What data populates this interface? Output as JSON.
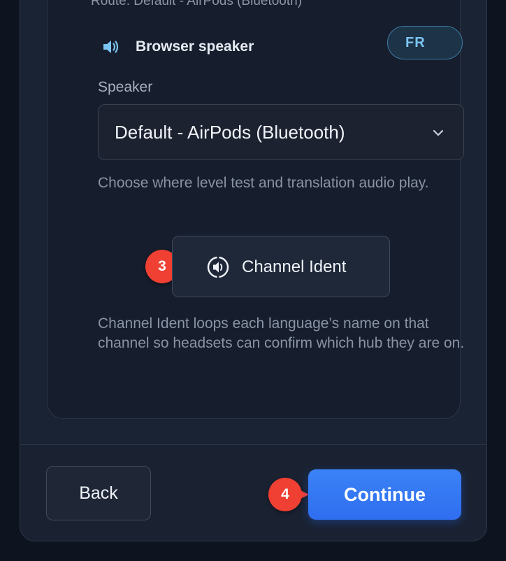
{
  "route_text": "Route: Default - AirPods (Bluetooth)",
  "speaker_row": {
    "icon": "speaker-wave-icon",
    "label": "Browser speaker",
    "language_pill": "FR"
  },
  "speaker_field": {
    "label": "Speaker",
    "selected": "Default - AirPods (Bluetooth)",
    "help": "Choose where level test and translation audio play."
  },
  "channel_ident": {
    "icon": "speaker-ident-icon",
    "label": "Channel Ident",
    "badge": "3",
    "help": "Channel Ident loops each language’s name on that channel so headsets can confirm which hub they are on."
  },
  "footer": {
    "back_label": "Back",
    "continue_label": "Continue",
    "continue_badge": "4"
  },
  "colors": {
    "accent": "#3b82f6",
    "badge": "#f04033",
    "pill_text": "#7cc4f1"
  }
}
